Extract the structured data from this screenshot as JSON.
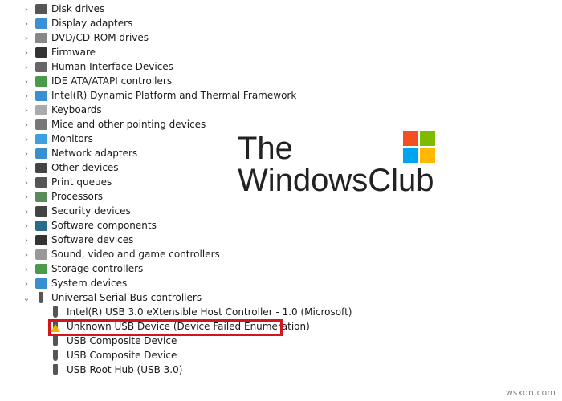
{
  "categories": [
    {
      "label": "Disk drives",
      "icon": "disk-drive-icon",
      "color": "#555"
    },
    {
      "label": "Display adapters",
      "icon": "display-adapter-icon",
      "color": "#3b8fd6"
    },
    {
      "label": "DVD/CD-ROM drives",
      "icon": "dvd-drive-icon",
      "color": "#888"
    },
    {
      "label": "Firmware",
      "icon": "firmware-icon",
      "color": "#333"
    },
    {
      "label": "Human Interface Devices",
      "icon": "hid-icon",
      "color": "#666"
    },
    {
      "label": "IDE ATA/ATAPI controllers",
      "icon": "ide-controller-icon",
      "color": "#4a9a4a"
    },
    {
      "label": "Intel(R) Dynamic Platform and Thermal Framework",
      "icon": "system-icon",
      "color": "#3a8fd0"
    },
    {
      "label": "Keyboards",
      "icon": "keyboard-icon",
      "color": "#aaa"
    },
    {
      "label": "Mice and other pointing devices",
      "icon": "mouse-icon",
      "color": "#777"
    },
    {
      "label": "Monitors",
      "icon": "monitor-icon",
      "color": "#3ca0e0"
    },
    {
      "label": "Network adapters",
      "icon": "network-adapter-icon",
      "color": "#3a8fd0"
    },
    {
      "label": "Other devices",
      "icon": "other-device-icon",
      "color": "#444"
    },
    {
      "label": "Print queues",
      "icon": "printer-icon",
      "color": "#555"
    },
    {
      "label": "Processors",
      "icon": "processor-icon",
      "color": "#5a8a5a"
    },
    {
      "label": "Security devices",
      "icon": "security-device-icon",
      "color": "#444"
    },
    {
      "label": "Software components",
      "icon": "software-component-icon",
      "color": "#2a6a8a"
    },
    {
      "label": "Software devices",
      "icon": "software-device-icon",
      "color": "#333"
    },
    {
      "label": "Sound, video and game controllers",
      "icon": "speaker-icon",
      "color": "#999"
    },
    {
      "label": "Storage controllers",
      "icon": "storage-controller-icon",
      "color": "#4a9a4a"
    },
    {
      "label": "System devices",
      "icon": "system-icon",
      "color": "#3a8fd0"
    },
    {
      "label": "Universal Serial Bus controllers",
      "icon": "usb-icon",
      "color": "#555",
      "expanded": true
    }
  ],
  "usb_children": [
    {
      "label": "Intel(R) USB 3.0 eXtensible Host Controller - 1.0 (Microsoft)",
      "warning": false
    },
    {
      "label": "Unknown USB Device (Device Failed Enumeration)",
      "warning": true
    },
    {
      "label": "USB Composite Device",
      "warning": false
    },
    {
      "label": "USB Composite Device",
      "warning": false
    },
    {
      "label": "USB Root Hub (USB 3.0)",
      "warning": false
    }
  ],
  "highlight_color": "#d3161d",
  "logo": {
    "line1": "The",
    "line2": "WindowsClub"
  },
  "watermark": "wsxdn.com"
}
